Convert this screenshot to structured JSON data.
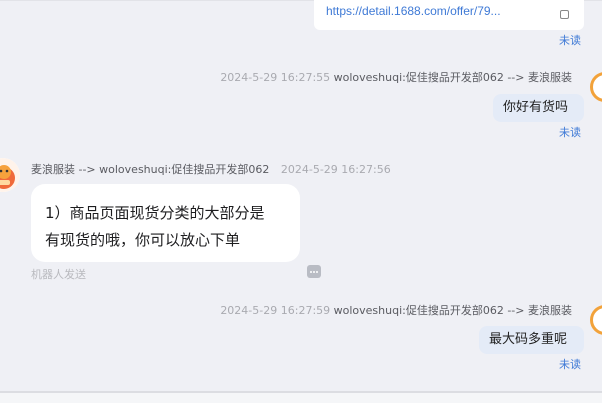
{
  "messages": {
    "link_card": {
      "url_text": "https://detail.1688.com/offer/79...",
      "status": "未读"
    },
    "msg1": {
      "time": "2024-5-29 16:27:55",
      "route": "woloveshuqi:促佳搜品开发部062 --> 麦浪服装",
      "text": "你好有货吗",
      "status": "未读"
    },
    "msg2": {
      "route": "麦浪服装 --> woloveshuqi:促佳搜品开发部062",
      "time": "2024-5-29 16:27:56",
      "text_line1": "1）商品页面现货分类的大部分是",
      "text_line2": "有现货的哦，你可以放心下单",
      "bot_note": "机器人发送"
    },
    "msg3": {
      "time": "2024-5-29 16:27:59",
      "route": "woloveshuqi:促佳搜品开发部062 --> 麦浪服装",
      "text": "最大码多重呢",
      "status": "未读"
    }
  }
}
